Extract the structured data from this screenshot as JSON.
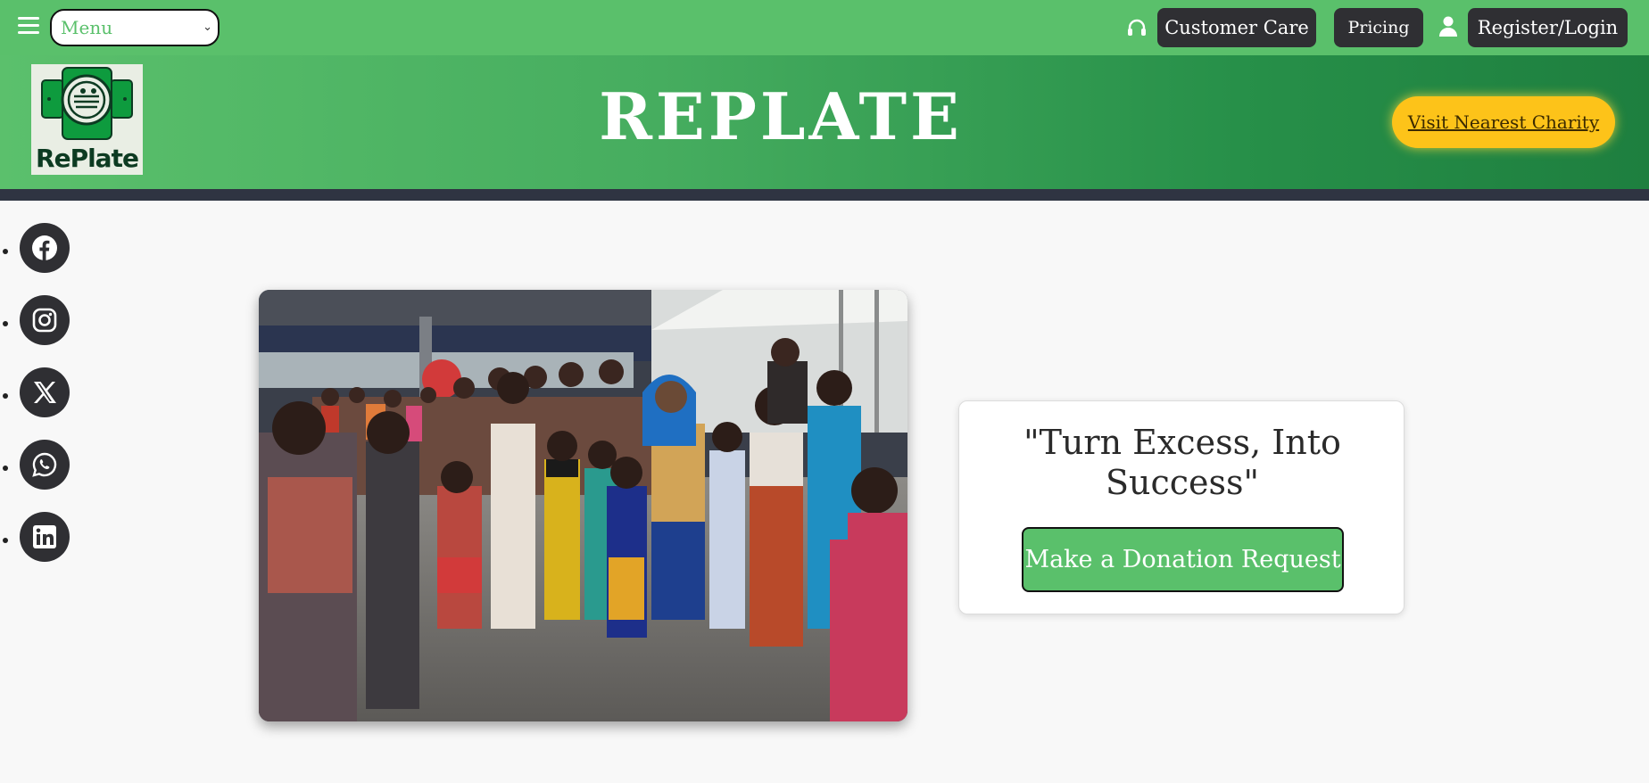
{
  "topbar": {
    "menu_icon": "hamburger-icon",
    "menu_select_value": "Menu",
    "customer_care_icon": "headset-icon",
    "customer_care_label": "Customer Care",
    "pricing_label": "Pricing",
    "register_icon": "user-icon",
    "register_label": "Register/Login"
  },
  "banner": {
    "logo_text": "RePlate",
    "brand_title": "REPLATE",
    "charity_button_label": "Visit Nearest Charity"
  },
  "social": {
    "items": [
      {
        "name": "facebook",
        "icon": "facebook-icon"
      },
      {
        "name": "instagram",
        "icon": "instagram-icon"
      },
      {
        "name": "x",
        "icon": "x-icon"
      },
      {
        "name": "whatsapp",
        "icon": "whatsapp-icon"
      },
      {
        "name": "linkedin",
        "icon": "linkedin-icon"
      }
    ]
  },
  "hero": {
    "photo": "photo of people queueing for food under a tent",
    "tagline": "\"Turn Excess, Into Success\"",
    "donate_button_label": "Make a Donation Request"
  },
  "colors": {
    "brand_green": "#5ac06b",
    "dark": "#2f2f33",
    "accent_yellow": "#fdc319",
    "divider": "#2f3442"
  }
}
